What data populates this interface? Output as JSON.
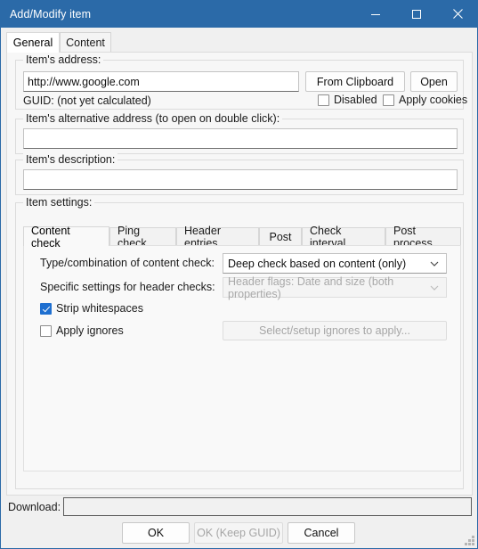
{
  "window": {
    "title": "Add/Modify item",
    "accent_color": "#2b6aa8",
    "controls": [
      {
        "name": "minimize",
        "glyph": "minimize-icon"
      },
      {
        "name": "maximize",
        "glyph": "maximize-icon"
      },
      {
        "name": "close",
        "glyph": "close-icon"
      }
    ]
  },
  "outer_tabs": [
    {
      "label": "General",
      "active": true
    },
    {
      "label": "Content",
      "active": false
    }
  ],
  "address_group": {
    "title": "Item's address:",
    "value": "http://www.google.com",
    "placeholder": "",
    "from_clipboard_label": "From Clipboard",
    "open_label": "Open",
    "guid_text": "GUID: (not yet calculated)",
    "disabled_label": "Disabled",
    "disabled_checked": false,
    "apply_cookies_label": "Apply cookies",
    "apply_cookies_checked": false
  },
  "alt_address_group": {
    "title": "Item's alternative address (to open on double click):",
    "value": "",
    "placeholder": ""
  },
  "description_group": {
    "title": "Item's description:",
    "value": "",
    "placeholder": ""
  },
  "item_settings": {
    "title": "Item settings:",
    "tabs": [
      {
        "label": "Content check",
        "active": true
      },
      {
        "label": "Ping check",
        "active": false
      },
      {
        "label": "Header entries",
        "active": false
      },
      {
        "label": "Post",
        "active": false
      },
      {
        "label": "Check interval",
        "active": false
      },
      {
        "label": "Post process",
        "active": false
      }
    ],
    "content_check": {
      "type_label": "Type/combination of content check:",
      "type_value": "Deep check based on content (only)",
      "header_label": "Specific settings for header checks:",
      "header_value": "Header flags: Date and size (both properties)",
      "header_disabled": true,
      "strip_whitespaces_label": "Strip whitespaces",
      "strip_whitespaces_checked": true,
      "apply_ignores_label": "Apply ignores",
      "apply_ignores_checked": false,
      "select_ignores_label": "Select/setup ignores to apply...",
      "select_ignores_disabled": true
    }
  },
  "footer": {
    "download_label": "Download:",
    "download_progress": "",
    "buttons": [
      {
        "label": "OK",
        "disabled": false
      },
      {
        "label": "OK (Keep GUID)",
        "disabled": true
      },
      {
        "label": "Cancel",
        "disabled": false
      }
    ]
  }
}
